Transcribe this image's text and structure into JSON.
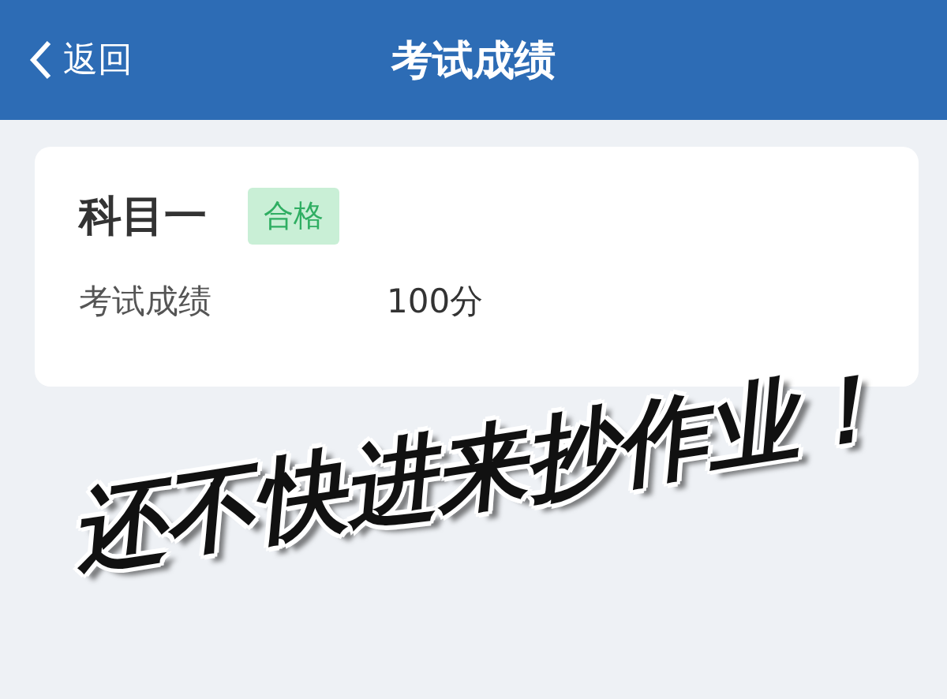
{
  "header": {
    "back_label": "返回",
    "title": "考试成绩"
  },
  "card": {
    "subject": "科目一",
    "badge": "合格",
    "rows": [
      {
        "label": "考试成绩",
        "value": "100分"
      }
    ]
  },
  "caption": "还不快进来抄作业！"
}
